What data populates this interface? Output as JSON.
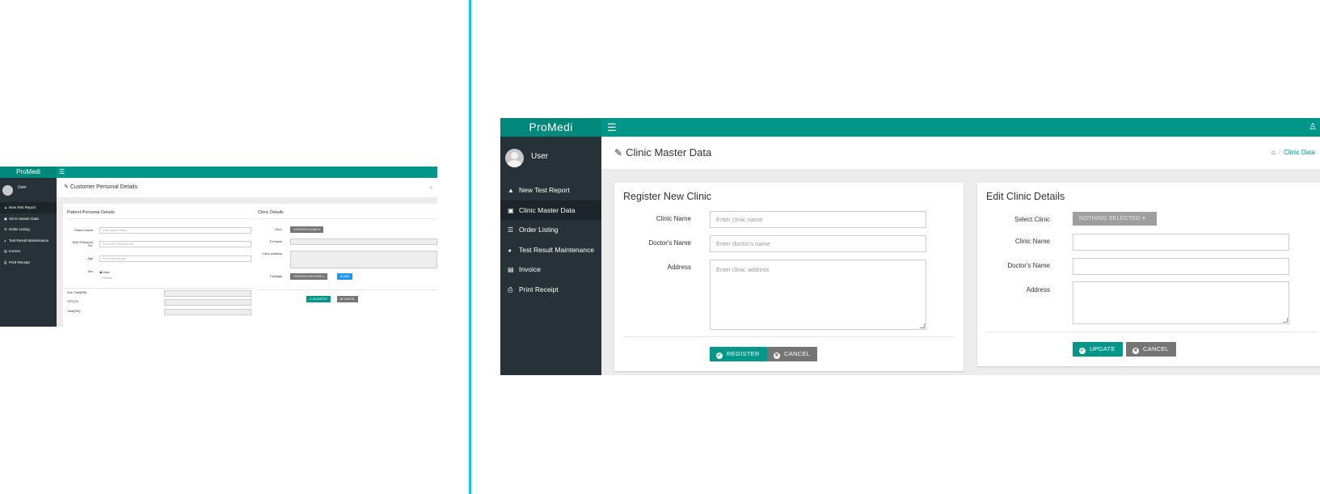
{
  "colors": {
    "primary": "#009688",
    "sidebar": "#263238",
    "accent_divider": "#1bc2ea",
    "button_gray": "#757575"
  },
  "app": {
    "brand": "ProMedi",
    "user": "User"
  },
  "sidebar": {
    "items": [
      {
        "label": "New Test Report",
        "icon": "flask-icon"
      },
      {
        "label": "Clinic Master Data",
        "icon": "camera-icon"
      },
      {
        "label": "Order Listing",
        "icon": "list-icon"
      },
      {
        "label": "Test Result Maintenance",
        "icon": "tachometer-icon"
      },
      {
        "label": "Invoice",
        "icon": "money-icon"
      },
      {
        "label": "Print Receipt",
        "icon": "print-icon"
      }
    ]
  },
  "mini": {
    "page_title": "Customer Personal Details",
    "patient_section": "Patient Personal Details",
    "clinic_section": "Clinic Details",
    "patient_name_label": "Patient Name",
    "patient_name_placeholder": "Enter patient name",
    "nric_label": "NRIC/Passport No.",
    "nric_placeholder": "Enter NRIC/Passport No.",
    "age_label": "Age",
    "age_placeholder": "Enter patient's age",
    "sex_label": "Sex",
    "sex_male": "Male",
    "sex_female": "Female",
    "clinic_label": "Clinic",
    "clinic_select": "CHOOSE A CLINIC",
    "dr_name_label": "Dr.Name",
    "clinic_address_label": "Clinic Address",
    "package_label": "Package",
    "package_select": "CHOOSE A PACKAGE",
    "add_button": "ADD",
    "register_button": "REGISTER",
    "cancel_button": "CANCEL",
    "sub_total_label": "Sub Total(RM)",
    "gst_label": "GST(%)",
    "total_label": "Total(RM)"
  },
  "main": {
    "page_title": "Clinic Master Data",
    "breadcrumb_current": "Clinic Data",
    "register": {
      "title": "Register New Clinic",
      "clinic_name_label": "Clinic Name",
      "clinic_name_placeholder": "Enter clinic name",
      "doctor_name_label": "Doctor's Name",
      "doctor_name_placeholder": "Enter doctor's name",
      "address_label": "Address",
      "address_placeholder": "Enter clinic address",
      "register_button": "REGISTER",
      "cancel_button": "CANCEL"
    },
    "edit": {
      "title": "Edit Clinic Details",
      "select_clinic_label": "Select Clinic",
      "select_value": "NOTHING SELECTED",
      "clinic_name_label": "Clinic Name",
      "doctor_name_label": "Doctor's Name",
      "address_label": "Address",
      "update_button": "UPDATE",
      "cancel_button": "CANCEL"
    }
  }
}
